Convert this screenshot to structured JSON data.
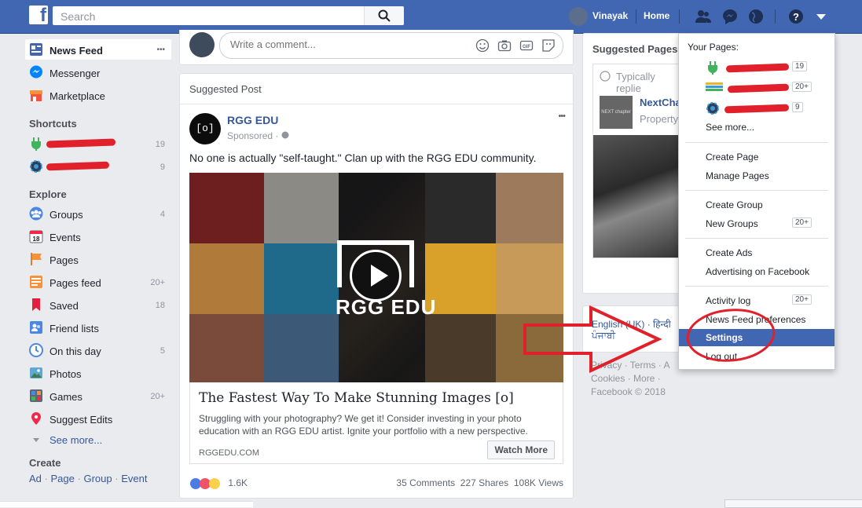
{
  "topbar": {
    "search_placeholder": "Search",
    "user_name": "Vinayak",
    "home_label": "Home"
  },
  "left": {
    "main_items": [
      {
        "label": "News Feed",
        "icon": "news-feed-icon"
      },
      {
        "label": "Messenger",
        "icon": "messenger-icon"
      },
      {
        "label": "Marketplace",
        "icon": "marketplace-icon"
      }
    ],
    "more_dots": "•••",
    "shortcuts_heading": "Shortcuts",
    "shortcuts": [
      {
        "count": "19"
      },
      {
        "count": "9"
      }
    ],
    "explore_heading": "Explore",
    "explore": [
      {
        "label": "Groups",
        "count": "4",
        "icon": "groups-icon"
      },
      {
        "label": "Events",
        "count": "",
        "icon": "events-icon"
      },
      {
        "label": "Pages",
        "count": "",
        "icon": "pages-icon"
      },
      {
        "label": "Pages feed",
        "count": "20+",
        "icon": "pages-feed-icon"
      },
      {
        "label": "Saved",
        "count": "18",
        "icon": "saved-icon"
      },
      {
        "label": "Friend lists",
        "count": "",
        "icon": "friend-lists-icon"
      },
      {
        "label": "On this day",
        "count": "5",
        "icon": "on-this-day-icon"
      },
      {
        "label": "Photos",
        "count": "",
        "icon": "photos-icon"
      },
      {
        "label": "Games",
        "count": "20+",
        "icon": "games-icon"
      },
      {
        "label": "Suggest Edits",
        "count": "",
        "icon": "suggest-edits-icon"
      }
    ],
    "see_more": "See more...",
    "create_heading": "Create",
    "create_links": [
      "Ad",
      "Page",
      "Group",
      "Event"
    ],
    "create_sep": "·"
  },
  "center": {
    "comment_placeholder": "Write a comment...",
    "post": {
      "header": "Suggested Post",
      "page_name": "RGG EDU",
      "sponsored": "Sponsored",
      "logo_text": "[o]",
      "text": "No one is actually \"self-taught.\" Clan up with the RGG EDU community.",
      "image_brand": "RGG EDU",
      "link_title": "The Fastest Way To Make Stunning Images [o]",
      "link_desc": "Struggling with your photography? We get it! Consider investing in your photo education with an RGG EDU artist. Ignite your portfolio with a new perspective.",
      "link_domain": "RGGEDU.COM",
      "cta": "Watch More",
      "reactions": "1.6K",
      "comments": "35 Comments",
      "shares": "227 Shares",
      "views": "108K Views",
      "more": "•••"
    }
  },
  "right": {
    "suggested_pages": "Suggested Pages",
    "typically_replies": "Typically replie",
    "next_name": "NextCha",
    "next_sub": "Property",
    "next_thumb": "NEXT chapter",
    "lang_line1": "English (UK) · हिन्दी",
    "lang_line2": "ਪੰਜਾਬੀ",
    "footer_line1": "Privacy · Terms · A",
    "footer_line2": "Cookies · More ·",
    "footer_copy": "Facebook © 2018"
  },
  "dropdown": {
    "your_pages": "Your Pages:",
    "pages": [
      {
        "count": "19"
      },
      {
        "count": "20+"
      },
      {
        "count": "9"
      }
    ],
    "see_more": "See more...",
    "items": [
      {
        "label": "Create Page",
        "badge": ""
      },
      {
        "label": "Manage Pages",
        "badge": ""
      },
      {
        "label": "Create Group",
        "badge": ""
      },
      {
        "label": "New Groups",
        "badge": "20+"
      },
      {
        "label": "Create Ads",
        "badge": ""
      },
      {
        "label": "Advertising on Facebook",
        "badge": ""
      },
      {
        "label": "Activity log",
        "badge": "20+"
      },
      {
        "label": "News Feed preferences",
        "badge": ""
      },
      {
        "label": "Settings",
        "badge": ""
      },
      {
        "label": "Log out",
        "badge": ""
      }
    ]
  },
  "colors": {
    "brand": "#4267b2",
    "annotation": "#e0202a"
  }
}
